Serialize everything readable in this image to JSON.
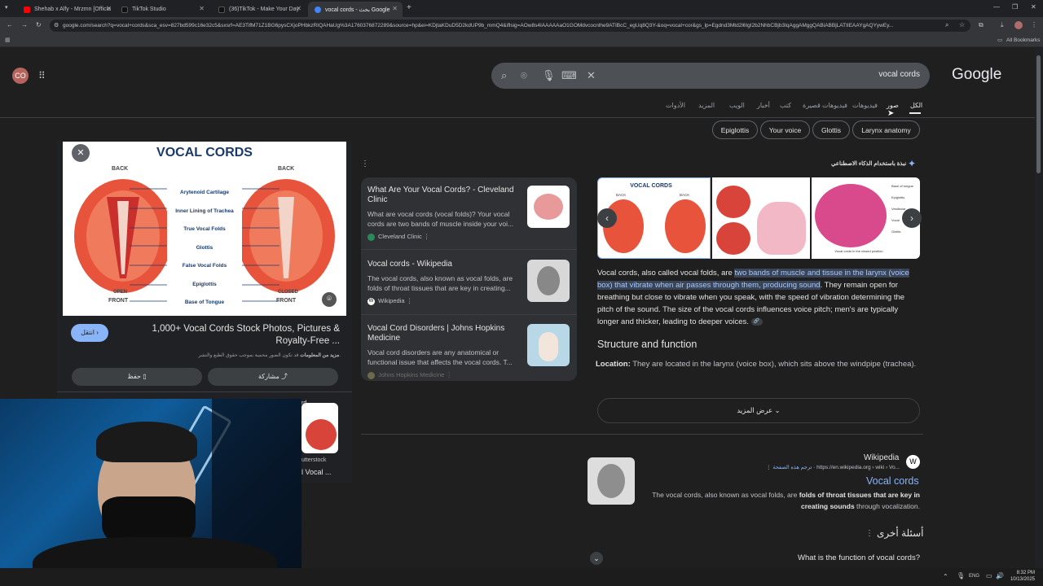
{
  "browser": {
    "tabs": [
      {
        "title": "Shehab x Alfy - Mrzmn [Officia",
        "color": "#ff0000"
      },
      {
        "title": "TikTok Studio",
        "color": "#000000"
      },
      {
        "title": "(36)TikTok - Make Your Day",
        "color": "#000000"
      },
      {
        "title": "vocal cords - بحث Google",
        "color": "#4285f4"
      }
    ],
    "new_tab": "+",
    "url": "google.com/search?q=vocal+cords&sca_esv=827bd599c16e32c5&sxsrf=AE3TifM71Z1BG6pysCXjoPHbkzRIQAHaUg%3A1760376872289&source=hp&ei=KDjtaKDuD5D2kdUP9b_mmQ4&iflsig=AOw8s4IAAAAAaO1GOMdvcocnlhe9ATIBcC_egUq8Q3Y-&oq=vocal+cor&gs_lp=Egdnd3Mtd2l6IgI2b2NhbCBjb3IqAggAMggQABiABBjLATIIEAAYgAQYywEy...",
    "bookmarks_label": "All Bookmarks"
  },
  "google": {
    "avatar": "CO",
    "logo": "Google",
    "query": "vocal cords",
    "nav_tabs": [
      "الكل",
      "صور",
      "فيديوهات",
      "فيديوهات قصيرة",
      "كتب",
      "أخبار",
      "الويب",
      "المزيد",
      "الأدوات"
    ],
    "chips": [
      "Larynx anatomy",
      "Glottis",
      "Your voice",
      "Epiglottis"
    ]
  },
  "image_viewer": {
    "image_title": "VOCAL CORDS",
    "labels": {
      "back": "BACK",
      "front": "FRONT",
      "open": "OPEN",
      "closed": "CLOSED",
      "parts": [
        "Arytenoid Cartilage",
        "Inner Lining of Trachea",
        "True Vocal Folds",
        "Glottis",
        "False Vocal Folds",
        "Epiglottis",
        "Base of Tongue"
      ]
    },
    "visit_button": "انتقل",
    "caption": "1,000+ Vocal Cords Stock Photos, Pictures & Royalty-Free ...",
    "rights_notice": "قد تكون الصور محمية بموجب حقوق الطبع والنشر.",
    "rights_link": "مزيد من المعلومات",
    "save_button": "حفظ",
    "share_button": "مشاركة",
    "side_partial": {
      "label1": "utterstock",
      "label2": "l Vocal ...",
      "label3": "rd"
    }
  },
  "results": [
    {
      "title": "What Are Your Vocal Cords? - Cleveland Clinic",
      "snippet": "What are vocal cords (vocal folds)? Your vocal cords are two bands of muscle inside your voi...",
      "source": "Cleveland Clinic"
    },
    {
      "title": "Vocal cords - Wikipedia",
      "snippet": "The vocal cords, also known as vocal folds, are folds of throat tissues that are key in creating...",
      "source": "Wikipedia"
    },
    {
      "title": "Vocal Cord Disorders | Johns Hopkins Medicine",
      "snippet": "Vocal cord disorders are any anatomical or functional issue that affects the vocal cords. T...",
      "source": "Johns Hopkins Medicine"
    }
  ],
  "ai_overview": {
    "header": "نبذة باستخدام الذكاء الاصطناعي",
    "image1_title": "VOCAL CORDS",
    "image1_back": "BACK",
    "image3_labels": [
      "Base of tongue",
      "Epiglottis",
      "Vestibular",
      "Vocal",
      "Glottis",
      "Vocal cords in the closed position"
    ],
    "intro": "Vocal cords, also called vocal folds, are",
    "highlight": "two bands of muscle and tissue in the larynx (voice box) that vibrate when air passes through them, producing sound",
    "rest": ". They remain open for breathing but close to vibrate when you speak, with the speed of vibration determining the pitch of the sound. The size of the vocal cords influences voice pitch; men's are typically longer and thicker, leading to deeper voices.",
    "section_heading": "Structure and function",
    "location_label": "Location:",
    "location_text": "They are located in the larynx (voice box), which sits above the windpipe (trachea).",
    "show_more": "عرض المزيد"
  },
  "wiki_result": {
    "site": "Wikipedia",
    "breadcrumb": "https://en.wikipedia.org › wiki › Vo...",
    "translate": "ترجم هذه الصفحة",
    "title": "Vocal cords",
    "snippet_a": "The vocal cords, also known as vocal folds, are ",
    "snippet_bold": "folds of throat tissues that are key in creating sounds",
    "snippet_b": " through vocalization."
  },
  "paa": {
    "heading": "أسئلة أخرى",
    "q1": "What is the function of vocal cords?"
  },
  "taskbar": {
    "lang": "ENG",
    "time": "8:32 PM",
    "date": "10/13/2025"
  }
}
